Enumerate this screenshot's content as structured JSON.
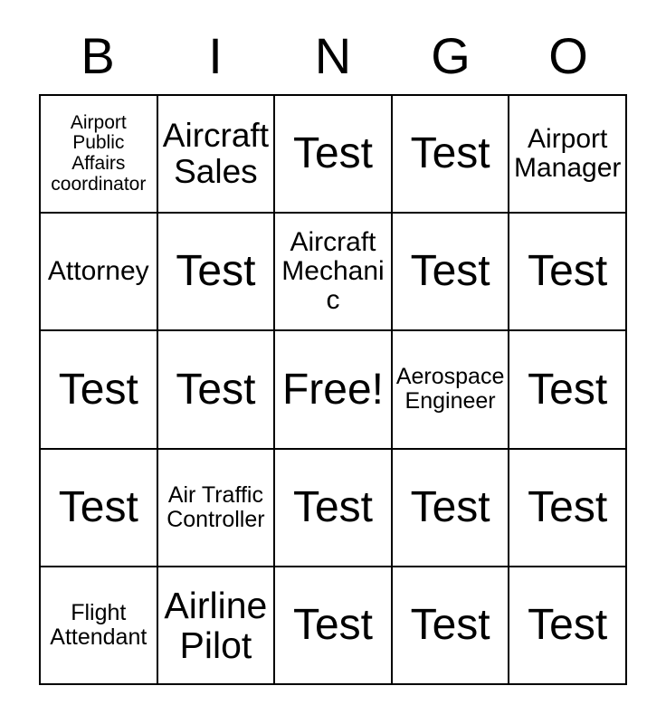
{
  "card": {
    "title": "BINGO Card",
    "background_color": "#ffffff",
    "line_color": "#000000",
    "text_color": "#000000"
  },
  "header": {
    "letters": [
      {
        "label": "B"
      },
      {
        "label": "I"
      },
      {
        "label": "N"
      },
      {
        "label": "G"
      },
      {
        "label": "O"
      }
    ]
  },
  "grid": {
    "columns": 5,
    "rows": 5,
    "free_space": "Free!",
    "cells": [
      {
        "text": "Airport Public Affairs coordinator",
        "size": "size-xxs",
        "column": "B",
        "row": 1
      },
      {
        "text": "Aircraft Sales",
        "size": "size-md",
        "column": "I",
        "row": 1
      },
      {
        "text": "Test",
        "size": "size-xl",
        "column": "N",
        "row": 1
      },
      {
        "text": "Test",
        "size": "size-xl",
        "column": "G",
        "row": 1
      },
      {
        "text": "Airport Manager",
        "size": "size-sm",
        "column": "O",
        "row": 1
      },
      {
        "text": "Attorney",
        "size": "size-sm",
        "column": "B",
        "row": 2
      },
      {
        "text": "Test",
        "size": "size-xl",
        "column": "I",
        "row": 2
      },
      {
        "text": "Aircraft Mechanic",
        "size": "size-sm",
        "column": "N",
        "row": 2
      },
      {
        "text": "Test",
        "size": "size-xl",
        "column": "G",
        "row": 2
      },
      {
        "text": "Test",
        "size": "size-xl",
        "column": "O",
        "row": 2
      },
      {
        "text": "Test",
        "size": "size-xl",
        "column": "B",
        "row": 3
      },
      {
        "text": "Test",
        "size": "size-xl",
        "column": "I",
        "row": 3
      },
      {
        "text": "Free!",
        "size": "size-xl",
        "column": "N",
        "row": 3
      },
      {
        "text": "Aerospace Engineer",
        "size": "size-xs",
        "column": "G",
        "row": 3
      },
      {
        "text": "Test",
        "size": "size-xl",
        "column": "O",
        "row": 3
      },
      {
        "text": "Test",
        "size": "size-xl",
        "column": "B",
        "row": 4
      },
      {
        "text": "Air Traffic Controller",
        "size": "size-xs",
        "column": "I",
        "row": 4
      },
      {
        "text": "Test",
        "size": "size-xl",
        "column": "N",
        "row": 4
      },
      {
        "text": "Test",
        "size": "size-xl",
        "column": "G",
        "row": 4
      },
      {
        "text": "Test",
        "size": "size-xl",
        "column": "O",
        "row": 4
      },
      {
        "text": "Flight Attendant",
        "size": "size-xs",
        "column": "B",
        "row": 5
      },
      {
        "text": "Airline Pilot",
        "size": "size-lg",
        "column": "I",
        "row": 5
      },
      {
        "text": "Test",
        "size": "size-xl",
        "column": "N",
        "row": 5
      },
      {
        "text": "Test",
        "size": "size-xl",
        "column": "G",
        "row": 5
      },
      {
        "text": "Test",
        "size": "size-xl",
        "column": "O",
        "row": 5
      }
    ]
  }
}
